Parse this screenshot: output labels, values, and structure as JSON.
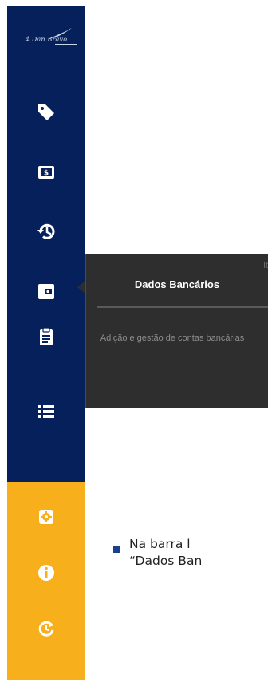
{
  "sidebar": {
    "logo_text": "4 Dan Bravo",
    "nav_items": [
      {
        "icon": "tag-icon"
      },
      {
        "icon": "dollar-bill-icon"
      },
      {
        "icon": "history-icon"
      },
      {
        "icon": "wallet-icon",
        "active": true
      },
      {
        "icon": "clipboard-icon"
      },
      {
        "icon": "list-icon"
      }
    ],
    "bottom_items": [
      {
        "icon": "gear-icon"
      },
      {
        "icon": "info-icon"
      },
      {
        "icon": "refresh-clock-icon"
      }
    ]
  },
  "tooltip": {
    "title": "Dados Bancários",
    "ghost_text": "It",
    "description": "Adição e gestão de contas bancárias"
  },
  "body": {
    "line1": "Na barra l",
    "line2": "“Dados Ban"
  },
  "colors": {
    "sidebar_top": "#05205b",
    "sidebar_bottom": "#f7b01b",
    "tooltip_bg": "#2e2e2e",
    "icon": "#ffffff"
  }
}
